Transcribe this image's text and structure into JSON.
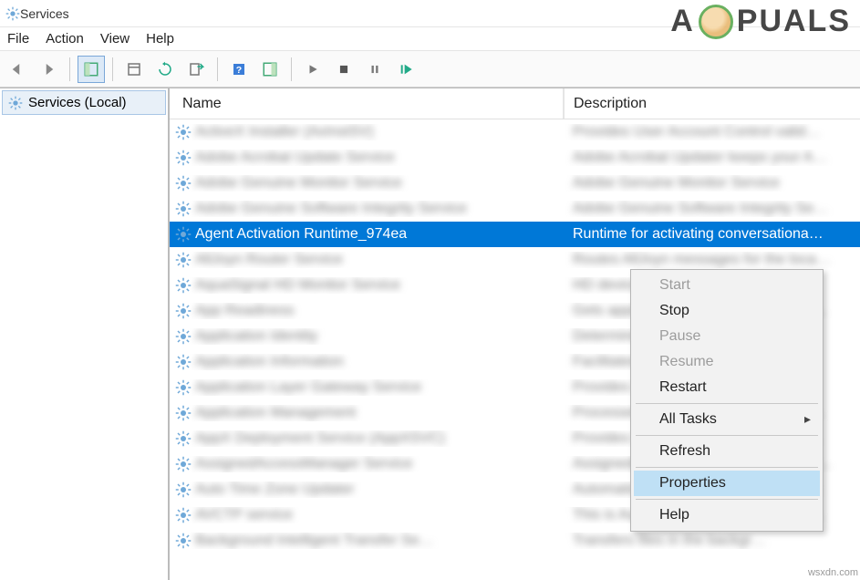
{
  "window": {
    "title": "Services"
  },
  "menu": {
    "file": "File",
    "action": "Action",
    "view": "View",
    "help": "Help"
  },
  "tree": {
    "root": "Services (Local)"
  },
  "columns": {
    "name": "Name",
    "description": "Description"
  },
  "selected": {
    "name": "Agent Activation Runtime_974ea",
    "description": "Runtime for activating conversationa…"
  },
  "context_menu": {
    "start": "Start",
    "stop": "Stop",
    "pause": "Pause",
    "resume": "Resume",
    "restart": "Restart",
    "all_tasks": "All Tasks",
    "refresh": "Refresh",
    "properties": "Properties",
    "help": "Help"
  },
  "watermark": {
    "prefix": "A",
    "suffix": "PUALS"
  },
  "footer": "wsxdn.com",
  "blurred_rows": [
    {
      "n": "ActiveX Installer (AxInstSV)",
      "d": "Provides User Account Control valid…"
    },
    {
      "n": "Adobe Acrobat Update Service",
      "d": "Adobe Acrobat Updater keeps your A…"
    },
    {
      "n": "Adobe Genuine Monitor Service",
      "d": "Adobe Genuine Monitor Service"
    },
    {
      "n": "Adobe Genuine Software Integrity Service",
      "d": "Adobe Genuine Software Integrity Se…"
    },
    {
      "n": "AllJoyn Router Service",
      "d": "Routes AllJoyn messages for the loca…"
    },
    {
      "n": "AquaSignal HD Monitor Service",
      "d": "HD device for AquaSignal"
    },
    {
      "n": "App Readiness",
      "d": "Gets apps ready for use the first time…"
    },
    {
      "n": "Application Identity",
      "d": "Determines and verifies the identity…"
    },
    {
      "n": "Application Information",
      "d": "Facilitates the running of interactive…"
    },
    {
      "n": "Application Layer Gateway Service",
      "d": "Provides support for 3rd party prot…"
    },
    {
      "n": "Application Management",
      "d": "Processes installation removal and s…"
    },
    {
      "n": "AppX Deployment Service (AppXSVC)",
      "d": "Provides infrastructure support for d…"
    },
    {
      "n": "AssignedAccessManager Service",
      "d": "AssignedAccessManager Service sup…"
    },
    {
      "n": "Auto Time Zone Updater",
      "d": "Automatically sets the system time z…"
    },
    {
      "n": "AVCTP service",
      "d": "This is Audio Video Control Transpor…"
    },
    {
      "n": "Background Intelligent Transfer Se…",
      "d": "Transfers files in the backgr…"
    }
  ]
}
